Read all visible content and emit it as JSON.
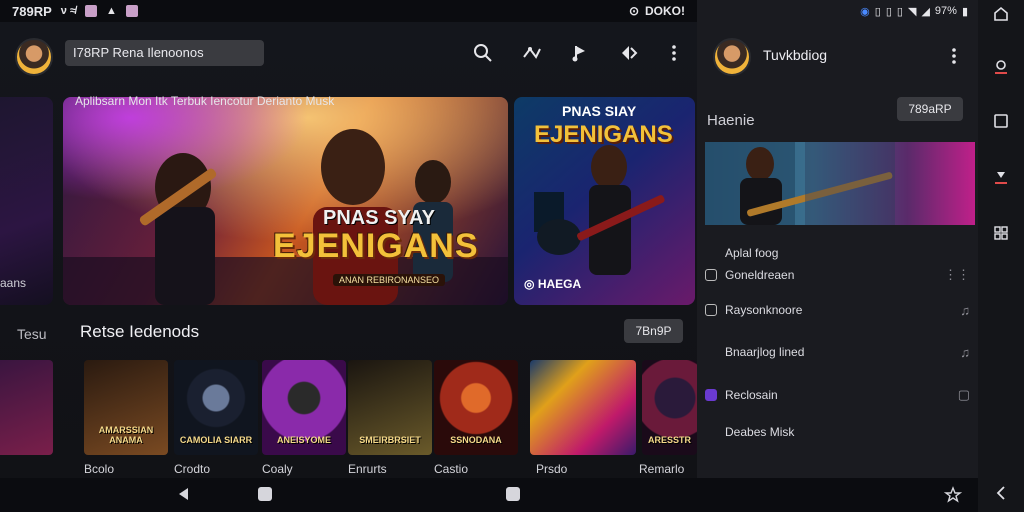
{
  "status": {
    "time": "789RP",
    "right_text": "DOKO!",
    "battery": "97%"
  },
  "search": {
    "value": "I78RP Rena Ilenoonos"
  },
  "hero": {
    "caption": "Aplibsarn Mon Itk Terbuk Iencotur Derianto Musk",
    "title": "EJENIGANS",
    "subtitle": "PNAS SYAY",
    "tag": "ANAN REBIRONANSEO",
    "secondary_title": "EJENIGANS",
    "secondary_sub": "PNAS SIAY",
    "secondary_badge": "HAEGA",
    "peek_label": "aans",
    "peek_label2": "Tesu"
  },
  "recommend": {
    "title": "Retse Iedenods",
    "pill": "7Bn9P",
    "tiles": [
      {
        "label": "Bcolo",
        "art": "AMARSSIAN ANAMA",
        "c1": "#2a1a10",
        "c2": "#7a4a22"
      },
      {
        "label": "Crodto",
        "art": "CAMOLIA SIARR",
        "c1": "#10151f",
        "c2": "#2a3a55"
      },
      {
        "label": "Coaly",
        "art": "ANEISYOME",
        "c1": "#6a1a8a",
        "c2": "#2a0a3a"
      },
      {
        "label": "Enrurts",
        "art": "SMEIRBRSIET",
        "c1": "#1a1510",
        "c2": "#6a5a2a"
      },
      {
        "label": "Castio",
        "art": "SSNODANA",
        "c1": "#2a0a0a",
        "c2": "#c0401a"
      },
      {
        "label": "Prsdo",
        "art": "",
        "c1": "#1a3a6a",
        "c2": "#c01a6a"
      },
      {
        "label": "Remarlo",
        "art": "ARESSTR",
        "c1": "#1a0a1a",
        "c2": "#6a1a3a"
      }
    ]
  },
  "right_panel": {
    "header_title": "Tuvkbdiog",
    "section": "Haenie",
    "pill": "789aRP",
    "items": [
      {
        "label": "Aplal foog",
        "icon": "none",
        "trailing": ""
      },
      {
        "label": "Goneldreaen",
        "icon": "square",
        "trailing": "⋮⋮"
      },
      {
        "label": "Raysonknoore",
        "icon": "square",
        "trailing": "♫"
      },
      {
        "label": "Bnaarjlog lined",
        "icon": "none",
        "trailing": "♫"
      },
      {
        "label": "Reclosain",
        "icon": "purple",
        "trailing": "▢"
      },
      {
        "label": "Deabes Misk",
        "icon": "none",
        "trailing": ""
      }
    ]
  },
  "colors": {
    "accent_gold": "#f3c13a",
    "panel_bg": "#1a1b20",
    "pill_bg": "#3a3b40"
  },
  "icons": {
    "topbar": [
      "search-icon",
      "shuffle-icon",
      "music-icon",
      "equalizer-icon",
      "more-vertical-icon"
    ],
    "rail": [
      "home-outline-icon",
      "player-icon",
      "square-icon",
      "player2-icon",
      "grid-icon",
      "back-icon"
    ],
    "bottom": [
      "back-nav-icon",
      "home-nav-icon",
      "recents-nav-icon",
      "star-plus-icon"
    ]
  }
}
